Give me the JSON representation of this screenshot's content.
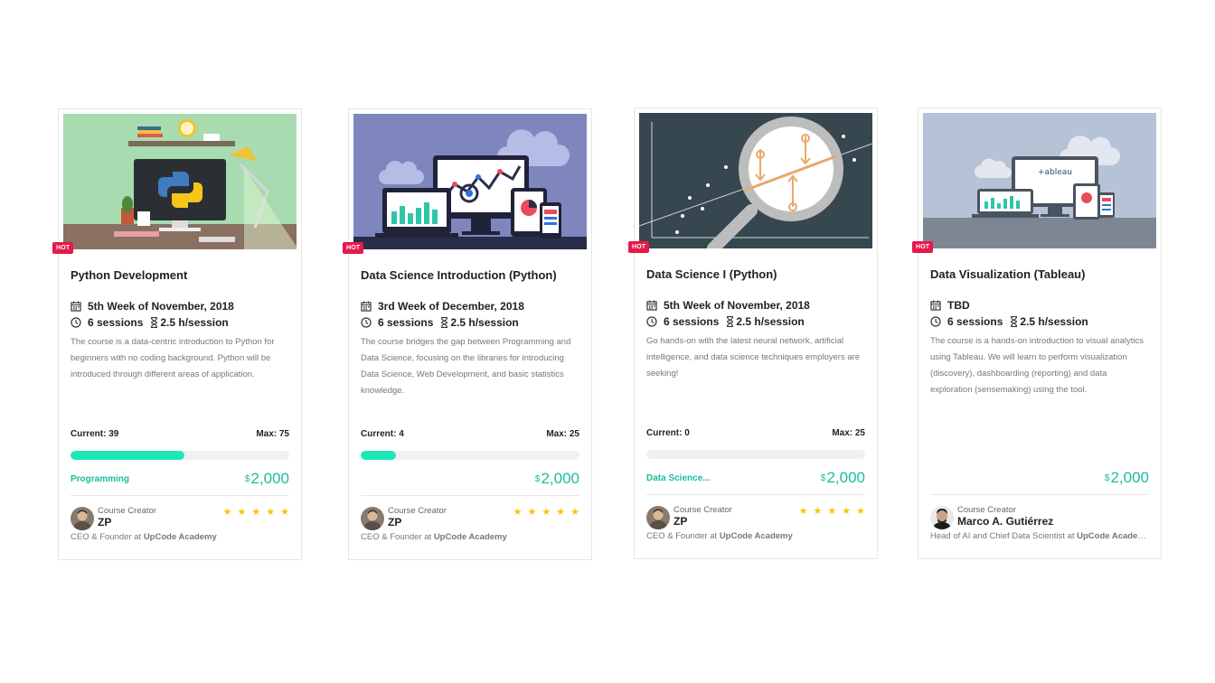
{
  "theme": {
    "accent": "#1de9b6",
    "price_color": "#1bbc9b",
    "hot_badge": "#e6194b",
    "star": "#ffc107"
  },
  "courses": [
    {
      "badge": "HOT",
      "title": "Python Development",
      "date": "5th Week of November, 2018",
      "sessions": "6 sessions",
      "duration": "2.5 h/session",
      "description": "The course is a data-centric introduction to Python for beginners with no coding background. Python will be introduced through different areas of application.",
      "current_label": "Current: 39",
      "max_label": "Max: 75",
      "enrollment_fraction": 0.52,
      "category": "Programming",
      "currency": "$",
      "price": "2,000",
      "creator_label": "Course Creator",
      "creator_name": "ZP",
      "role": "CEO & Founder",
      "at": "at",
      "org": "UpCode Academy",
      "rating": 5,
      "star_glyph": "★",
      "image": "python-desk-illustration"
    },
    {
      "badge": "HOT",
      "title": "Data Science Introduction (Python)",
      "date": "3rd Week of December, 2018",
      "sessions": "6 sessions",
      "duration": "2.5 h/session",
      "description": "The course bridges the gap between Programming and Data Science, focusing on the libraries for introducing Data Science, Web Development, and basic statistics knowledge.",
      "current_label": "Current: 4",
      "max_label": "Max: 25",
      "enrollment_fraction": 0.16,
      "category": "",
      "currency": "$",
      "price": "2,000",
      "creator_label": "Course Creator",
      "creator_name": "ZP",
      "role": "CEO & Founder",
      "at": "at",
      "org": "UpCode Academy",
      "rating": 5,
      "star_glyph": "★",
      "image": "devices-analytics-illustration"
    },
    {
      "badge": "HOT",
      "title": "Data Science I (Python)",
      "date": "5th Week of November, 2018",
      "sessions": "6 sessions",
      "duration": "2.5 h/session",
      "description": "Go hands-on with the latest neural network, artificial intelligence, and data science techniques employers are seeking!",
      "current_label": "Current: 0",
      "max_label": "Max: 25",
      "enrollment_fraction": 0.0,
      "category": "Data Science...",
      "currency": "$",
      "price": "2,000",
      "creator_label": "Course Creator",
      "creator_name": "ZP",
      "role": "CEO & Founder",
      "at": "at",
      "org": "UpCode Academy",
      "rating": 5,
      "star_glyph": "★",
      "image": "regression-magnifier-illustration"
    },
    {
      "badge": "HOT",
      "title": "Data Visualization (Tableau)",
      "date": "TBD",
      "sessions": "6 sessions",
      "duration": "2.5 h/session",
      "description": "The course is a hands-on introduction to visual analytics using Tableau. We will learn to perform visualization (discovery), dashboarding (reporting) and data exploration (sensemaking) using the tool.",
      "current_label": "",
      "max_label": "",
      "enrollment_fraction": null,
      "category": "",
      "currency": "$",
      "price": "2,000",
      "creator_label": "Course Creator",
      "creator_name": "Marco A. Gutiérrez",
      "role": "Head of AI and Chief Data Scientist",
      "at": "at",
      "org": "UpCode Academy",
      "rating": 0,
      "star_glyph": "★",
      "image": "tableau-devices-illustration",
      "image_text": "+ableau"
    }
  ]
}
